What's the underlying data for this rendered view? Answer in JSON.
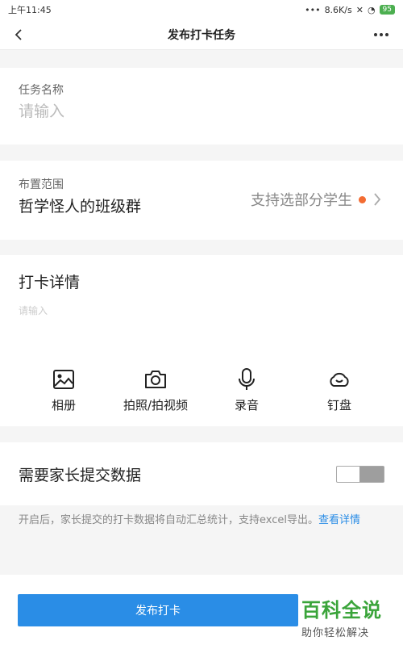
{
  "status_bar": {
    "time": "上午11:45",
    "network_speed": "8.6K/s",
    "battery": "95"
  },
  "nav": {
    "title": "发布打卡任务",
    "back_icon": "chevron-left-icon",
    "more_icon": "more-dots-icon"
  },
  "task_name": {
    "label": "任务名称",
    "placeholder": "请输入",
    "value": ""
  },
  "scope": {
    "label": "布置范围",
    "value": "哲学怪人的班级群",
    "hint": "支持选部分学生",
    "dot_color": "#f36c32"
  },
  "detail": {
    "title": "打卡详情",
    "placeholder": "请输入",
    "tools": [
      {
        "label": "相册",
        "icon": "image-icon"
      },
      {
        "label": "拍照/拍视频",
        "icon": "camera-icon"
      },
      {
        "label": "录音",
        "icon": "microphone-icon"
      },
      {
        "label": "钉盘",
        "icon": "cloud-drive-icon"
      }
    ]
  },
  "parent_data": {
    "label": "需要家长提交数据",
    "enabled": false,
    "tip": "开启后，家长提交的打卡数据将自动汇总统计，支持excel导出。",
    "tip_link": "查看详情"
  },
  "footer": {
    "publish_label": "发布打卡",
    "accent_color": "#2a8de6"
  },
  "watermark": {
    "title": "百科全说",
    "subtitle": "助你轻松解决"
  }
}
